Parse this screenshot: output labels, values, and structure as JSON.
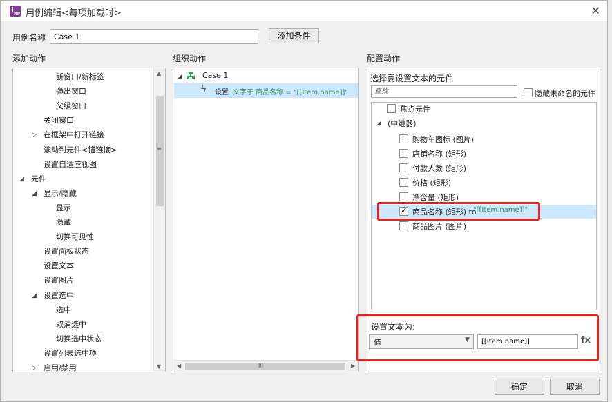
{
  "window": {
    "title": "用例编辑<每项加载时>",
    "close_glyph": "✕",
    "icon_text": "RP"
  },
  "usecase": {
    "label": "用例名称",
    "value": "Case 1",
    "add_condition": "添加条件"
  },
  "sections": {
    "add_action": "添加动作",
    "organize_action": "组织动作",
    "configure_action": "配置动作"
  },
  "add_action_tree": [
    {
      "label": "新窗口/新标签",
      "level": 3,
      "arrow": ""
    },
    {
      "label": "弹出窗口",
      "level": 3,
      "arrow": ""
    },
    {
      "label": "父级窗口",
      "level": 3,
      "arrow": ""
    },
    {
      "label": "关闭窗口",
      "level": 2,
      "arrow": ""
    },
    {
      "label": "在框架中打开链接",
      "level": 2,
      "arrow": "▷"
    },
    {
      "label": "滚动到元件<锚链接>",
      "level": 2,
      "arrow": ""
    },
    {
      "label": "设置自适应视图",
      "level": 2,
      "arrow": ""
    },
    {
      "label": "元件",
      "level": 1,
      "arrow": "◢"
    },
    {
      "label": "显示/隐藏",
      "level": 2,
      "arrow": "◢"
    },
    {
      "label": "显示",
      "level": 3,
      "arrow": ""
    },
    {
      "label": "隐藏",
      "level": 3,
      "arrow": ""
    },
    {
      "label": "切换可见性",
      "level": 3,
      "arrow": ""
    },
    {
      "label": "设置面板状态",
      "level": 2,
      "arrow": ""
    },
    {
      "label": "设置文本",
      "level": 2,
      "arrow": ""
    },
    {
      "label": "设置图片",
      "level": 2,
      "arrow": ""
    },
    {
      "label": "设置选中",
      "level": 2,
      "arrow": "◢"
    },
    {
      "label": "选中",
      "level": 3,
      "arrow": ""
    },
    {
      "label": "取消选中",
      "level": 3,
      "arrow": ""
    },
    {
      "label": "切换选中状态",
      "level": 3,
      "arrow": ""
    },
    {
      "label": "设置列表选中项",
      "level": 2,
      "arrow": ""
    },
    {
      "label": "启用/禁用",
      "level": 2,
      "arrow": "▷"
    }
  ],
  "organize": {
    "case_label": "Case 1",
    "action_prefix": "设置",
    "action_detail": "文字于 商品名称 = \"[[Item.name]]\""
  },
  "configure": {
    "select_label": "选择要设置文本的元件",
    "search_placeholder": "查找",
    "hide_unnamed": "隐藏未命名的元件",
    "focus_widget": "焦点元件",
    "repeater_label": "(中继器)",
    "items": [
      {
        "label": "购物车图标 (图片)",
        "checked": false,
        "suffix": ""
      },
      {
        "label": "店铺名称 (矩形)",
        "checked": false,
        "suffix": ""
      },
      {
        "label": "付款人数 (矩形)",
        "checked": false,
        "suffix": ""
      },
      {
        "label": "价格 (矩形)",
        "checked": false,
        "suffix": ""
      },
      {
        "label": "净含量 (矩形)",
        "checked": false,
        "suffix": ""
      },
      {
        "label": "商品名称 (矩形) to ",
        "checked": true,
        "suffix": "\"[[Item.name]]\""
      },
      {
        "label": "商品图片 (图片)",
        "checked": false,
        "suffix": ""
      }
    ],
    "set_text_label": "设置文本为:",
    "value_type": "值",
    "value_text": "[[Item.name]]",
    "fx_label": "fx"
  },
  "footer": {
    "ok": "确定",
    "cancel": "取消"
  },
  "scroll": {
    "h_mid": "III",
    "v_mid": "≡"
  },
  "colors": {
    "highlight_red": "#e8231d",
    "selection_blue": "#cce8ff",
    "value_green": "#2e8b57"
  }
}
